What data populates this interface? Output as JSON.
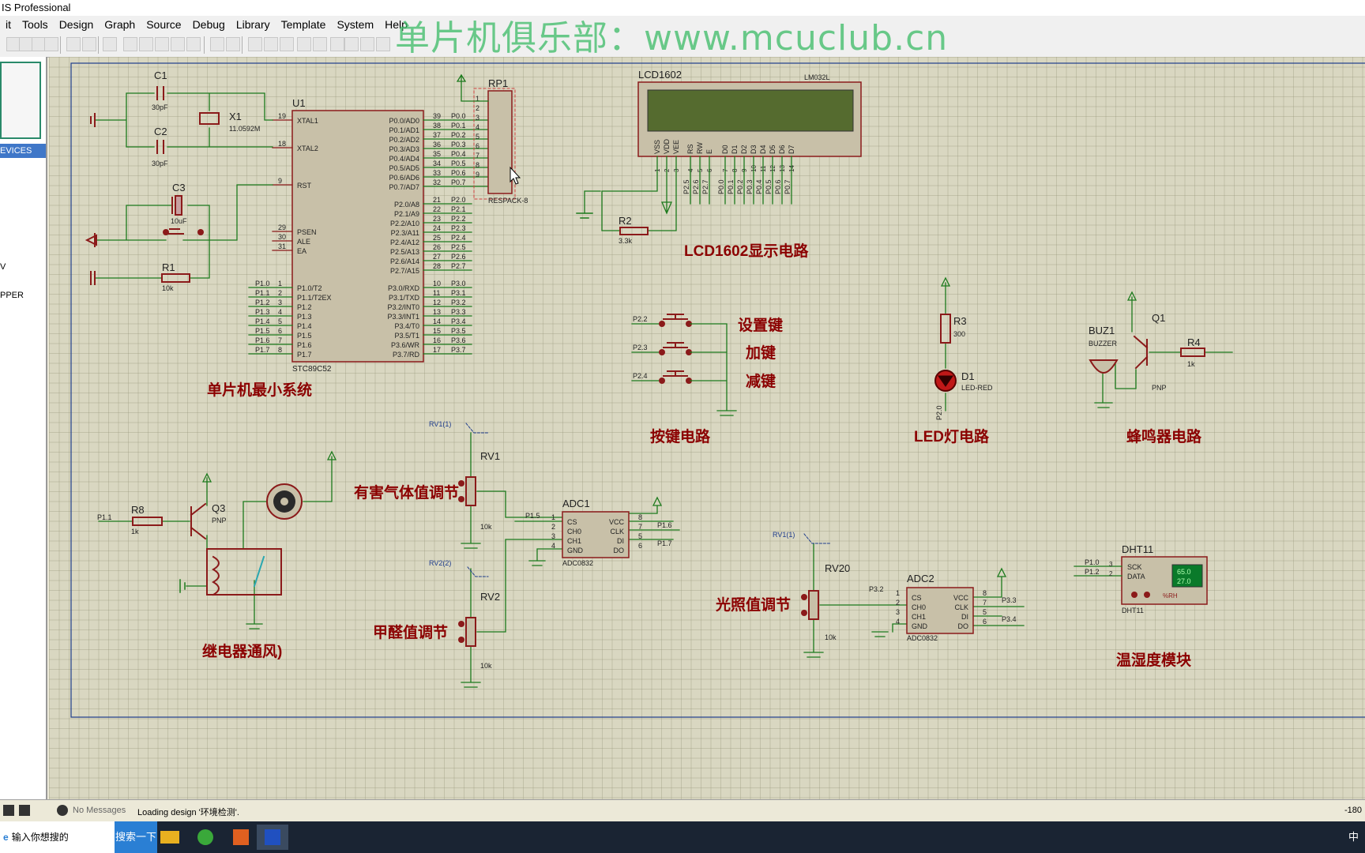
{
  "window": {
    "title": "IS Professional"
  },
  "menu": [
    "it",
    "Tools",
    "Design",
    "Graph",
    "Source",
    "Debug",
    "Library",
    "Template",
    "System",
    "Help"
  ],
  "watermark": "单片机俱乐部：www.mcuclub.cn",
  "left_panel": {
    "header": "EVICES",
    "items": [
      "V",
      "PPER"
    ]
  },
  "status": {
    "message_count": "No Messages",
    "loading": "Loading design '环境检测'.",
    "coord": "-180"
  },
  "taskbar": {
    "search_placeholder": "输入你想搜的",
    "search_button": "搜索一下",
    "lang": "中"
  },
  "schematic": {
    "section_labels": {
      "mcu": "单片机最小系统",
      "lcd": "LCD1602显示电路",
      "keys": "按键电路",
      "led": "LED灯电路",
      "buzzer": "蜂鸣器电路",
      "relay": "继电器通风)",
      "gas": "有害气体值调节",
      "formaldehyde": "甲醛值调节",
      "light": "光照值调节",
      "dht": "温湿度模块",
      "key_set": "设置键",
      "key_add": "加键",
      "key_sub": "减键"
    },
    "mcu": {
      "ref": "U1",
      "part": "STC89C52",
      "left_top_pins": [
        [
          "19",
          "XTAL1"
        ],
        [
          "18",
          "XTAL2"
        ],
        [
          "9",
          "RST"
        ]
      ],
      "left_mid_pins": [
        [
          "29",
          "PSEN"
        ],
        [
          "30",
          "ALE"
        ],
        [
          "31",
          "EA"
        ]
      ],
      "p1_pins": [
        [
          "1",
          "P1.0/T2",
          "P1.0"
        ],
        [
          "2",
          "P1.1/T2EX",
          "P1.1"
        ],
        [
          "3",
          "P1.2",
          "P1.2"
        ],
        [
          "4",
          "P1.3",
          "P1.3"
        ],
        [
          "5",
          "P1.4",
          "P1.4"
        ],
        [
          "6",
          "P1.5",
          "P1.5"
        ],
        [
          "7",
          "P1.6",
          "P1.6"
        ],
        [
          "8",
          "P1.7",
          "P1.7"
        ]
      ],
      "p0_pins": [
        [
          "39",
          "P0.0/AD0",
          "P0.0"
        ],
        [
          "38",
          "P0.1/AD1",
          "P0.1"
        ],
        [
          "37",
          "P0.2/AD2",
          "P0.2"
        ],
        [
          "36",
          "P0.3/AD3",
          "P0.3"
        ],
        [
          "35",
          "P0.4/AD4",
          "P0.4"
        ],
        [
          "34",
          "P0.5/AD5",
          "P0.5"
        ],
        [
          "33",
          "P0.6/AD6",
          "P0.6"
        ],
        [
          "32",
          "P0.7/AD7",
          "P0.7"
        ]
      ],
      "p2_pins": [
        [
          "21",
          "P2.0/A8",
          "P2.0"
        ],
        [
          "22",
          "P2.1/A9",
          "P2.1"
        ],
        [
          "23",
          "P2.2/A10",
          "P2.2"
        ],
        [
          "24",
          "P2.3/A11",
          "P2.3"
        ],
        [
          "25",
          "P2.4/A12",
          "P2.4"
        ],
        [
          "26",
          "P2.5/A13",
          "P2.5"
        ],
        [
          "27",
          "P2.6/A14",
          "P2.6"
        ],
        [
          "28",
          "P2.7/A15",
          "P2.7"
        ]
      ],
      "p3_pins": [
        [
          "10",
          "P3.0/RXD",
          "P3.0"
        ],
        [
          "11",
          "P3.1/TXD",
          "P3.1"
        ],
        [
          "12",
          "P3.2/INT0",
          "P3.2"
        ],
        [
          "13",
          "P3.3/INT1",
          "P3.3"
        ],
        [
          "14",
          "P3.4/T0",
          "P3.4"
        ],
        [
          "15",
          "P3.5/T1",
          "P3.5"
        ],
        [
          "16",
          "P3.6/WR",
          "P3.6"
        ],
        [
          "17",
          "P3.7/RD",
          "P3.7"
        ]
      ]
    },
    "parts": {
      "c1": "C1",
      "c1v": "30pF",
      "c2": "C2",
      "c2v": "30pF",
      "x1": "X1",
      "x1v": "11.0592M",
      "c3": "C3",
      "c3v": "10uF",
      "r1": "R1",
      "r1v": "10k",
      "rp1": "RP1",
      "rp1v": "RESPACK-8",
      "lcd": "LCD1602",
      "lcdv": "LM032L",
      "r2": "R2",
      "r2v": "3.3k",
      "lcd_pins": [
        "VSS",
        "VDD",
        "VEE",
        "RS",
        "RW",
        "E",
        "D0",
        "D1",
        "D2",
        "D3",
        "D4",
        "D5",
        "D6",
        "D7"
      ],
      "lcd_nums": [
        "1",
        "2",
        "3",
        "4",
        "5",
        "6",
        "7",
        "8",
        "9",
        "10",
        "11",
        "12",
        "13",
        "14"
      ],
      "lcd_nets": [
        "P2.5",
        "P2.6",
        "P2.7",
        "P0.0",
        "P0.1",
        "P0.2",
        "P0.3",
        "P0.4",
        "P0.5",
        "P0.6",
        "P0.7"
      ],
      "key_nets": [
        "P2.2",
        "P2.3",
        "P2.4"
      ],
      "r3": "R3",
      "r3v": "300",
      "d1": "D1",
      "d1v": "LED-RED",
      "d1net": "P2.0",
      "buz": "BUZ1",
      "buzv": "BUZZER",
      "q1": "Q1",
      "q1v": "PNP",
      "r4": "R4",
      "r4v": "1k",
      "r8": "R8",
      "r8v": "1k",
      "r8net": "P1.1",
      "q3": "Q3",
      "q3v": "PNP",
      "rv1": "RV1",
      "rv1v": "10k",
      "rv1probe": "RV1(1)",
      "rv2": "RV2",
      "rv2v": "10k",
      "rv2probe": "RV2(2)",
      "rv20": "RV20",
      "rv20v": "10k",
      "rv20probe": "RV1(1)",
      "adc1": "ADC1",
      "adc1v": "ADC0832",
      "adc1_nets": [
        "P1.5",
        "P1.6",
        "P1.7"
      ],
      "adc2": "ADC2",
      "adc2v": "ADC0832",
      "adc2_nets": [
        "P3.2",
        "P3.3",
        "P3.4"
      ],
      "adc_left": [
        [
          "1",
          "CS"
        ],
        [
          "2",
          "CH0"
        ],
        [
          "3",
          "CH1"
        ],
        [
          "4",
          "GND"
        ]
      ],
      "adc_right": [
        [
          "8",
          "VCC"
        ],
        [
          "7",
          "CLK"
        ],
        [
          "5",
          "DI"
        ],
        [
          "6",
          "DO"
        ]
      ],
      "dht": "DHT11",
      "dhtv": "DHT11",
      "dht_pins": [
        [
          "3",
          "SCK",
          "P1.0"
        ],
        [
          "2",
          "DATA",
          "P1.2"
        ]
      ],
      "dht_temp": "65.0",
      "dht_hum": "27.0",
      "dht_unit": "%RH"
    }
  },
  "colors": {
    "wire": "#1c7a1c",
    "part": "#8b1a1a",
    "body": "#c8c0a8",
    "label": "#8b0000"
  }
}
